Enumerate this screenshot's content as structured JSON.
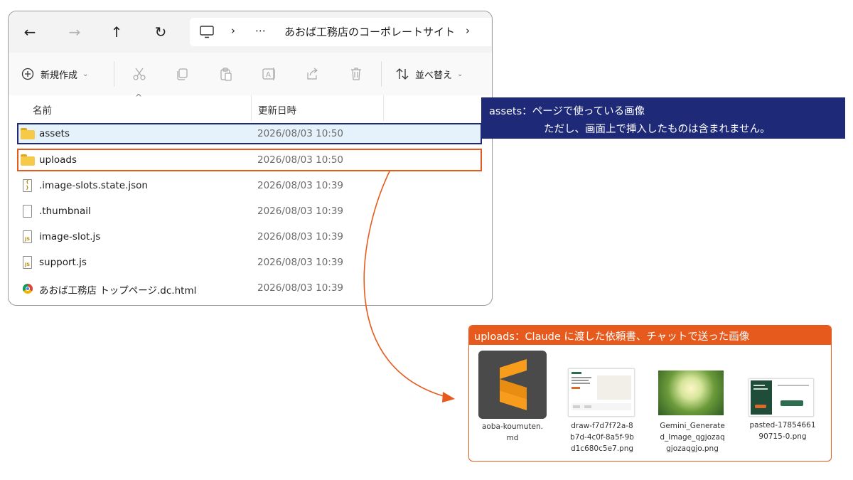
{
  "explorer": {
    "nav": {
      "back_icon": "←",
      "forward_icon": "→",
      "up_icon": "↑",
      "refresh_icon": "↻"
    },
    "address": {
      "monitor_icon": "monitor",
      "chevron1": "›",
      "ellipsis": "⋯",
      "path": "あおば工務店のコーポレートサイト",
      "chevron2": "›"
    },
    "toolbar": {
      "new_label": "新規作成",
      "new_caret": "⌄",
      "sort_label": "並べ替え",
      "sort_caret": "⌄"
    },
    "columns": {
      "name": "名前",
      "modified": "更新日時",
      "sort_indicator": "^"
    },
    "rows": [
      {
        "name": "assets",
        "date": "2026/08/03 10:50",
        "icon": "folder"
      },
      {
        "name": "uploads",
        "date": "2026/08/03 10:50",
        "icon": "folder"
      },
      {
        "name": ".image-slots.state.json",
        "date": "2026/08/03 10:39",
        "icon": "json-file",
        "badge": "{ }"
      },
      {
        "name": ".thumbnail",
        "date": "2026/08/03 10:39",
        "icon": "blank-file"
      },
      {
        "name": "image-slot.js",
        "date": "2026/08/03 10:39",
        "icon": "js-file",
        "badge": "JS"
      },
      {
        "name": "support.js",
        "date": "2026/08/03 10:39",
        "icon": "js-file",
        "badge": "JS"
      },
      {
        "name": "あおば工務店 トップページ.dc.html",
        "date": "2026/08/03 10:39",
        "icon": "chrome"
      }
    ]
  },
  "callouts": {
    "assets_line1": "assets：ページで使っている画像",
    "assets_line2": "ただし、画面上で挿入したものは含まれません。",
    "uploads_title": "uploads：Claude に渡した依頼書、チャットで送った画像"
  },
  "uploads_files": [
    {
      "line1": "aoba-koumuten.",
      "line2": "md",
      "line3": "",
      "icon": "sublime-text-icon"
    },
    {
      "line1": "draw-f7d7f72a-8",
      "line2": "b7d-4c0f-8a5f-9b",
      "line3": "d1c680c5e7.png",
      "icon": "document-thumbnail"
    },
    {
      "line1": "Gemini_Generate",
      "line2": "d_Image_qgjozaq",
      "line3": "gjozaqgjo.png",
      "icon": "bokeh-photo-thumbnail"
    },
    {
      "line1": "pasted-17854661",
      "line2": "90715-0.png",
      "line3": "",
      "icon": "screenshot-thumbnail"
    }
  ],
  "colors": {
    "assets_accent": "#1e2a78",
    "uploads_accent": "#e75a1d",
    "folder": "#f7c948",
    "selected_row": "#e5f1fb"
  }
}
